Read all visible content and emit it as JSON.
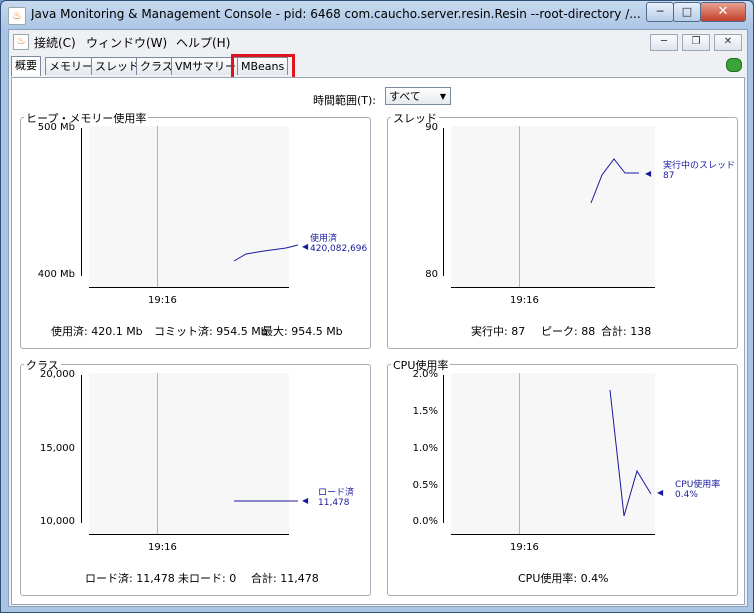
{
  "window": {
    "title": "Java Monitoring & Management Console - pid: 6468 com.caucho.server.resin.Resin --root-directory /...",
    "controls": {
      "min": "─",
      "max": "□",
      "close": "✕"
    }
  },
  "menubar": {
    "items": [
      "接続(C)",
      "ウィンドウ(W)",
      "ヘルプ(H)"
    ],
    "mdi": {
      "min": "─",
      "restore": "❐",
      "close": "✕"
    }
  },
  "tabs": [
    "概要",
    "メモリー",
    "スレッド",
    "クラス",
    "VMサマリー",
    "MBeans"
  ],
  "time_range": {
    "label": "時間範囲(T):",
    "value": "すべて"
  },
  "panels": {
    "heap": {
      "title": "ヒープ・メモリー使用率",
      "y_top": "500 Mb",
      "y_bottom": "400 Mb",
      "x_tick": "19:16",
      "legend_name": "使用済",
      "legend_value": "420,082,696",
      "stats": [
        "使用済: 420.1 Mb",
        "コミット済: 954.5 Mb",
        "最大: 954.5 Mb"
      ]
    },
    "threads": {
      "title": "スレッド",
      "y_top": "90",
      "y_bottom": "80",
      "x_tick": "19:16",
      "legend_name": "実行中のスレッド",
      "legend_value": "87",
      "stats": [
        "実行中: 87",
        "ピーク: 88",
        "合計: 138"
      ]
    },
    "classes": {
      "title": "クラス",
      "y_top": "20,000",
      "y_mid": "15,000",
      "y_bottom": "10,000",
      "x_tick": "19:16",
      "legend_name": "ロード済",
      "legend_value": "11,478",
      "stats": [
        "ロード済: 11,478",
        "未ロード: 0",
        "合計: 11,478"
      ]
    },
    "cpu": {
      "title": "CPU使用率",
      "y_ticks": [
        "2.0%",
        "1.5%",
        "1.0%",
        "0.5%",
        "0.0%"
      ],
      "x_tick": "19:16",
      "legend_name": "CPU使用率",
      "legend_value": "0.4%",
      "stats": [
        "CPU使用率: 0.4%"
      ]
    }
  },
  "chart_data": [
    {
      "type": "line",
      "title": "ヒープ・メモリー使用率",
      "ylim": [
        400,
        500
      ],
      "unit": "Mb",
      "series": [
        {
          "name": "使用済",
          "values": [
            409,
            412,
            413,
            414,
            415,
            416,
            418,
            420.1
          ]
        }
      ]
    },
    {
      "type": "line",
      "title": "スレッド",
      "ylim": [
        80,
        90
      ],
      "series": [
        {
          "name": "実行中のスレッド",
          "values": [
            85,
            87,
            88,
            87,
            87
          ]
        }
      ]
    },
    {
      "type": "line",
      "title": "クラス",
      "ylim": [
        10000,
        20000
      ],
      "series": [
        {
          "name": "ロード済",
          "values": [
            11478,
            11478
          ]
        }
      ]
    },
    {
      "type": "line",
      "title": "CPU使用率",
      "ylim": [
        0,
        2.0
      ],
      "unit": "%",
      "series": [
        {
          "name": "CPU使用率",
          "values": [
            1.8,
            0.1,
            0.7,
            0.4
          ]
        }
      ]
    }
  ],
  "colors": {
    "series": "#1a1a9c",
    "highlight": "#e0141e"
  }
}
